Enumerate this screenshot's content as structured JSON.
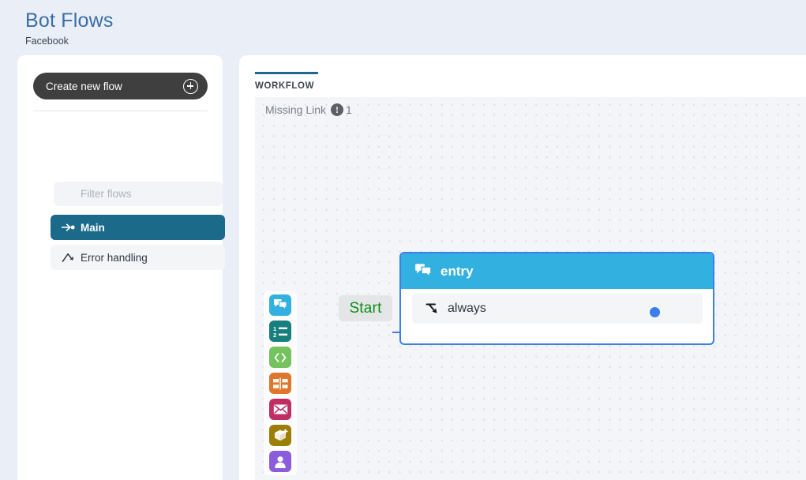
{
  "header": {
    "title": "Bot Flows",
    "subtitle": "Facebook"
  },
  "sidebar": {
    "create_flow_label": "Create new flow",
    "create_flow_icon": "plus-circle-icon",
    "filter": {
      "placeholder": "Filter flows",
      "value": "",
      "icon": "funnel-icon"
    },
    "items": [
      {
        "label": "Main",
        "icon": "arrow-dot-icon",
        "selected": true
      },
      {
        "label": "Error handling",
        "icon": "branch-error-icon",
        "selected": false
      }
    ]
  },
  "main": {
    "tabs": [
      {
        "label": "WORKFLOW",
        "active": true
      }
    ],
    "status": {
      "label": "Missing Link",
      "icon": "warning-exclamation-icon",
      "count": "1"
    },
    "palette": [
      {
        "name": "message-node",
        "icon": "speech-bubbles-icon",
        "color": "#32b0df"
      },
      {
        "name": "options-node",
        "icon": "numbered-list-icon",
        "color": "#17807f"
      },
      {
        "name": "code-node",
        "icon": "code-brackets-icon",
        "color": "#74c35f"
      },
      {
        "name": "layout-node",
        "icon": "layout-blocks-icon",
        "color": "#e0762d"
      },
      {
        "name": "email-node",
        "icon": "envelope-icon",
        "color": "#bf2d63"
      },
      {
        "name": "integration-node",
        "icon": "package-plus-icon",
        "color": "#9c7d08"
      },
      {
        "name": "user-node",
        "icon": "person-icon",
        "color": "#8b5cdb"
      }
    ],
    "canvas": {
      "start_label": "Start",
      "node": {
        "title": "entry",
        "title_icon": "speech-bubbles-icon",
        "branches": [
          {
            "label": "always",
            "icon": "branch-arrow-icon"
          }
        ],
        "port_in": "input-port",
        "port_out": "output-port"
      }
    }
  },
  "colors": {
    "page_background": "#eaeef7",
    "brand_title": "#3a6ea5",
    "accent_teal": "#1b6a8a",
    "node_header": "#32b0df",
    "node_border": "#3d7fea",
    "start_text": "#0e8f16"
  }
}
